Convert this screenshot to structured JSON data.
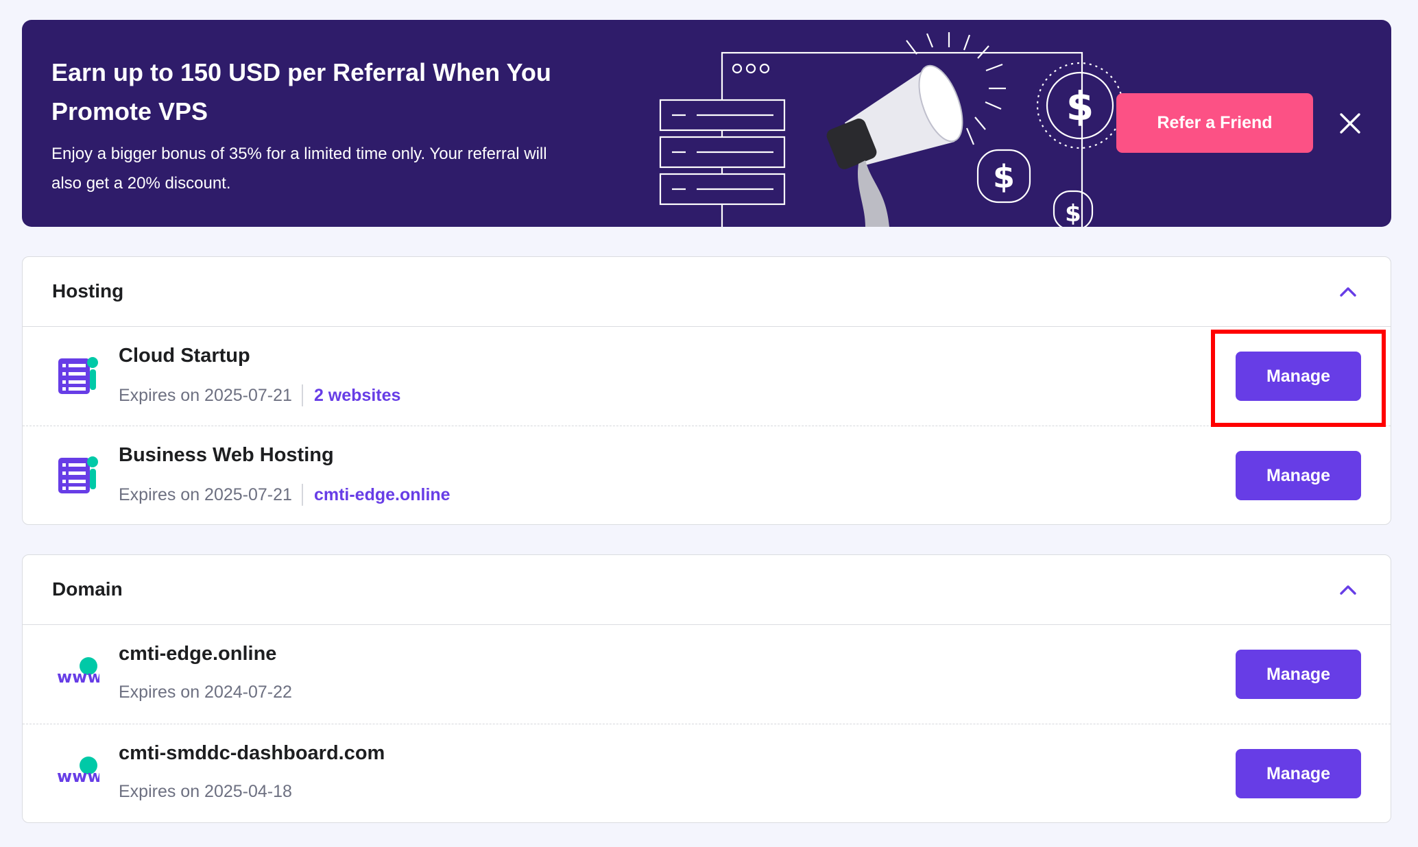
{
  "banner": {
    "title_line1": "Earn up to 150 USD per Referral When You",
    "title_line2": "Promote VPS",
    "text_line1": "Enjoy a bigger bonus of 35% for a limited time only. Your referral will",
    "text_line2": "also get a 20% discount.",
    "cta_label": "Refer a Friend",
    "close_icon": "close-icon"
  },
  "hosting": {
    "title": "Hosting",
    "items": [
      {
        "name": "Cloud Startup",
        "expires": "Expires on 2025-07-21",
        "link": "2 websites",
        "action": "Manage"
      },
      {
        "name": "Business Web Hosting",
        "expires": "Expires on 2025-07-21",
        "link": "cmti-edge.online",
        "action": "Manage"
      }
    ]
  },
  "domain": {
    "title": "Domain",
    "items": [
      {
        "name": "cmti-edge.online",
        "expires": "Expires on 2024-07-22",
        "action": "Manage"
      },
      {
        "name": "cmti-smddc-dashboard.com",
        "expires": "Expires on 2025-04-18",
        "action": "Manage"
      }
    ]
  },
  "colors": {
    "banner_bg": "#2f1c6a",
    "cta": "#fc5185",
    "primary": "#673de6",
    "accent_teal": "#00c9a7",
    "highlight": "#ff0000"
  }
}
